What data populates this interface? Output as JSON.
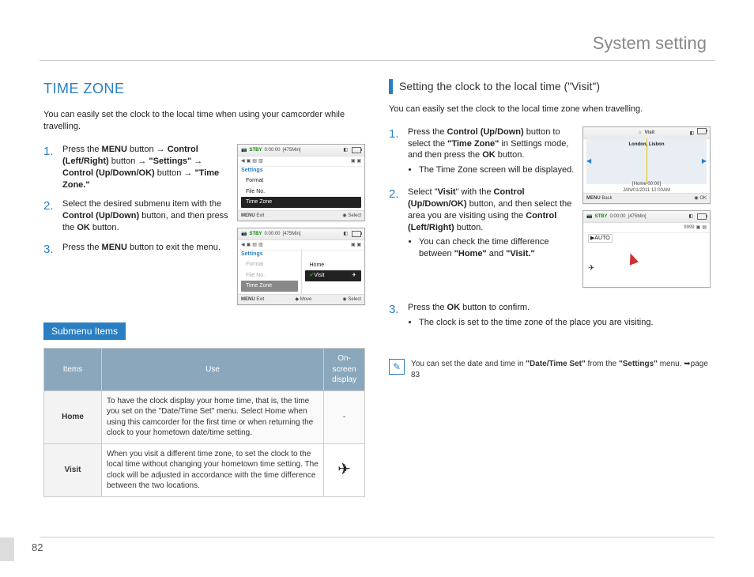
{
  "header": {
    "title": "System setting"
  },
  "page_number": "82",
  "left": {
    "title": "TIME ZONE",
    "intro": "You can easily set the clock to the local time when using your camcorder while travelling.",
    "steps": [
      {
        "num": "1.",
        "pre": "Press the ",
        "b1": "MENU",
        "mid1": " button → ",
        "b2": "Control (Left/Right)",
        "mid2": "  button → ",
        "b3": "\"Settings\"",
        "mid3": " → ",
        "b4": "Control (Up/Down/OK)",
        "mid4": " button → ",
        "b5": "\"Time Zone.\""
      },
      {
        "num": "2.",
        "pre": "Select the desired submenu item with the ",
        "b1": "Control (Up/Down)",
        "mid1": " button, and then press the ",
        "b2": "OK",
        "tail": " button."
      },
      {
        "num": "3.",
        "pre": "Press the ",
        "b1": "MENU",
        "tail": " button to exit the menu."
      }
    ],
    "submenu_heading": "Submenu Items",
    "table": {
      "headers": [
        "Items",
        "Use",
        "On-screen display"
      ],
      "rows": [
        {
          "item": "Home",
          "use": "To have the clock display your home time, that is, the time you set on the \"Date/Time Set\" menu. Select Home when using this camcorder for the first time or when returning the clock to your hometown date/time setting.",
          "display": "-"
        },
        {
          "item": "Visit",
          "use": "When you visit a different time zone, to set the clock to the local time without changing your hometown time setting. The clock will be adjusted in accordance with the time difference between the two locations.",
          "display": "✈"
        }
      ]
    },
    "lcd1": {
      "stby": "STBY",
      "time": "0:00:00",
      "remain": "[475Min]",
      "settings": "Settings",
      "items": [
        "Format",
        "File No.",
        "Time Zone"
      ],
      "menu": "MENU",
      "exit": "Exit",
      "select": "Select"
    },
    "lcd2": {
      "stby": "STBY",
      "time": "0:00:00",
      "remain": "[475Min]",
      "settings": "Settings",
      "left_items": [
        "Format",
        "File No.",
        "Time Zone"
      ],
      "right_items": [
        "Home",
        "Visit"
      ],
      "menu": "MENU",
      "exit": "Exit",
      "move": "Move",
      "select": "Select"
    }
  },
  "right": {
    "title": "Setting the clock to the local time (\"Visit\")",
    "intro": "You can easily set the clock to the local time zone when travelling.",
    "steps": [
      {
        "num": "1.",
        "pre": "Press the ",
        "b1": "Control (Up/Down)",
        "mid1": " button to select the ",
        "b2": "\"Time Zone\"",
        "mid2": " in Settings mode, and then press the ",
        "b3": "OK",
        "tail": " button.",
        "bullets": [
          "The Time Zone screen will be displayed."
        ]
      },
      {
        "num": "2.",
        "pre": "Select \"",
        "b1": "Visit",
        "mid1": "\" with the ",
        "b2": "Control (Up/Down/OK)",
        "mid2": " button, and then select the area you are visiting using the ",
        "b3": "Control (Left/Right)",
        "tail": " button.",
        "bullets_rich": {
          "pre": "You can check the time difference between ",
          "b1": "\"Home\"",
          "mid": " and ",
          "b2": "\"Visit.\""
        }
      },
      {
        "num": "3.",
        "pre": "Press the ",
        "b1": "OK",
        "tail": " button to confirm.",
        "bullets": [
          "The clock is set to the time zone of the place you are visiting."
        ]
      }
    ],
    "lcd_map": {
      "visit": "Visit",
      "city": "London, Lisbon",
      "home_line": "[Home 00:00]",
      "date_line": "JAN/01/2011 12:00AM",
      "menu": "MENU",
      "back": "Back",
      "ok": "OK"
    },
    "lcd_pin": {
      "stby": "STBY",
      "time": "0:00:00",
      "remain": "[475Min]",
      "cnt": "9999",
      "auto": "AUTO"
    },
    "note": {
      "pre": "You can set the date and time in ",
      "b1": "\"Date/Time Set\"",
      "mid": " from the ",
      "b2": "\"Settings\"",
      "tail": " menu. ➥page 83"
    }
  }
}
